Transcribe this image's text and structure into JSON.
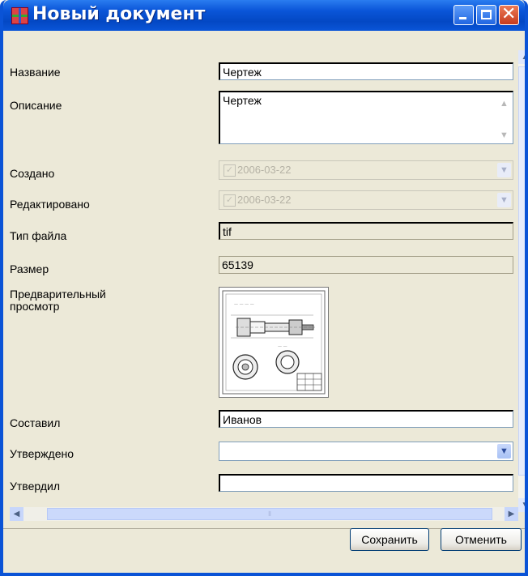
{
  "window": {
    "title": "Новый документ"
  },
  "fields": {
    "name": {
      "label": "Название",
      "value": "Чертеж"
    },
    "description": {
      "label": "Описание",
      "value": "Чертеж"
    },
    "created": {
      "label": "Создано",
      "value": "2006-03-22",
      "checked": true
    },
    "edited": {
      "label": "Редактировано",
      "value": "2006-03-22",
      "checked": true
    },
    "file_type": {
      "label": "Тип файла",
      "value": "tif"
    },
    "size": {
      "label": "Размер",
      "value": "65139"
    },
    "preview": {
      "label": "Предварительный просмотр"
    },
    "author": {
      "label": "Составил",
      "value": "Иванов"
    },
    "approved_date": {
      "label": "Утверждено",
      "value": ""
    },
    "approver": {
      "label": "Утвердил",
      "value": ""
    }
  },
  "buttons": {
    "save": "Сохранить",
    "cancel": "Отменить"
  },
  "colors": {
    "titlebar": "#0a55d8",
    "window_bg": "#ece9d8"
  }
}
